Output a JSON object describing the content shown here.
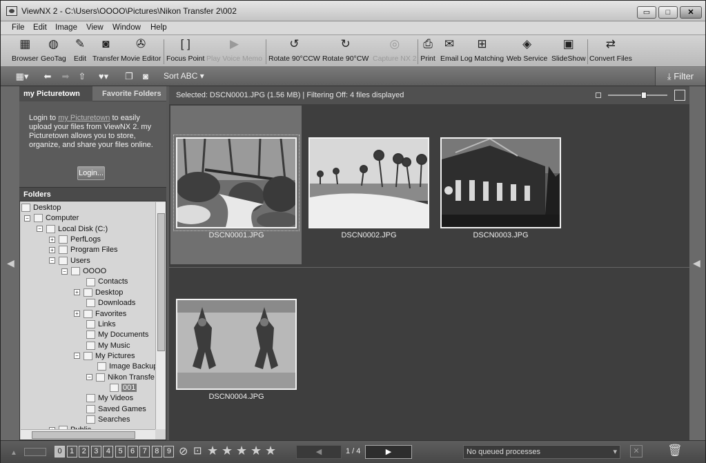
{
  "window": {
    "title": "ViewNX 2 - C:\\Users\\OOOO\\Pictures\\Nikon Transfer 2\\002",
    "min_label": "▭",
    "max_label": "□",
    "close_label": "✕"
  },
  "menu": [
    "File",
    "Edit",
    "Image",
    "View",
    "Window",
    "Help"
  ],
  "toolbar": [
    {
      "label": "Browser",
      "icon": "browser-icon",
      "glyph": "▦",
      "enabled": true
    },
    {
      "label": "GeoTag",
      "icon": "globe-icon",
      "glyph": "◍",
      "enabled": true
    },
    {
      "label": "Edit",
      "icon": "pencil-icon",
      "glyph": "✎",
      "enabled": true
    },
    {
      "label": "Transfer",
      "icon": "camera-icon",
      "glyph": "◙",
      "enabled": true
    },
    {
      "label": "Movie Editor",
      "icon": "film-reel-icon",
      "glyph": "✇",
      "enabled": true
    },
    {
      "label": "Focus Point",
      "icon": "focus-bracket-icon",
      "glyph": "[ ]",
      "enabled": true
    },
    {
      "label": "Play Voice Memo",
      "icon": "play-memo-icon",
      "glyph": "▶",
      "enabled": false
    },
    {
      "label": "Rotate 90°CCW",
      "icon": "rotate-ccw-icon",
      "glyph": "↺",
      "enabled": true
    },
    {
      "label": "Rotate 90°CW",
      "icon": "rotate-cw-icon",
      "glyph": "↻",
      "enabled": true
    },
    {
      "label": "Capture NX 2",
      "icon": "capture-nx-icon",
      "glyph": "◎",
      "enabled": false
    },
    {
      "label": "Print",
      "icon": "printer-icon",
      "glyph": "⎙",
      "enabled": true
    },
    {
      "label": "Email",
      "icon": "envelope-icon",
      "glyph": "✉",
      "enabled": true
    },
    {
      "label": "Log Matching",
      "icon": "log-matching-icon",
      "glyph": "⊞",
      "enabled": true
    },
    {
      "label": "Web Service",
      "icon": "web-service-icon",
      "glyph": "◈",
      "enabled": true
    },
    {
      "label": "SlideShow",
      "icon": "slideshow-icon",
      "glyph": "▣",
      "enabled": true
    },
    {
      "label": "Convert Files",
      "icon": "convert-files-icon",
      "glyph": "⇄",
      "enabled": true
    }
  ],
  "toolbar2": {
    "sort_label": "Sort ABC ▾",
    "filter_label": "Filter"
  },
  "left_panel": {
    "tab_active": "my Picturetown",
    "tab_inactive": "Favorite Folders",
    "text_pre": "Login to ",
    "text_link": "my Picturetown",
    "text_post": " to easily upload your files from ViewNX 2. my Picturetown allows you to store, organize, and share your files online.",
    "login_label": "Login...",
    "folders_header": "Folders"
  },
  "tree": [
    {
      "label": "Desktop",
      "indent": 0,
      "toggle": ""
    },
    {
      "label": "Computer",
      "indent": 1,
      "toggle": "−"
    },
    {
      "label": "Local Disk (C:)",
      "indent": 2,
      "toggle": "−"
    },
    {
      "label": "PerfLogs",
      "indent": 3,
      "toggle": "+"
    },
    {
      "label": "Program Files",
      "indent": 3,
      "toggle": "+"
    },
    {
      "label": "Users",
      "indent": 3,
      "toggle": "−"
    },
    {
      "label": "OOOO",
      "indent": 4,
      "toggle": "−"
    },
    {
      "label": "Contacts",
      "indent": 5,
      "toggle": ""
    },
    {
      "label": "Desktop",
      "indent": 5,
      "toggle": "+"
    },
    {
      "label": "Downloads",
      "indent": 5,
      "toggle": ""
    },
    {
      "label": "Favorites",
      "indent": 5,
      "toggle": "+"
    },
    {
      "label": "Links",
      "indent": 5,
      "toggle": ""
    },
    {
      "label": "My Documents",
      "indent": 5,
      "toggle": ""
    },
    {
      "label": "My Music",
      "indent": 5,
      "toggle": ""
    },
    {
      "label": "My Pictures",
      "indent": 5,
      "toggle": "−"
    },
    {
      "label": "Image Backup",
      "indent": 6,
      "toggle": ""
    },
    {
      "label": "Nikon Transfe",
      "indent": 6,
      "toggle": "−"
    },
    {
      "label": "001",
      "indent": 7,
      "toggle": "",
      "selected": true
    },
    {
      "label": "My Videos",
      "indent": 5,
      "toggle": ""
    },
    {
      "label": "Saved Games",
      "indent": 5,
      "toggle": ""
    },
    {
      "label": "Searches",
      "indent": 5,
      "toggle": ""
    },
    {
      "label": "Public",
      "indent": 3,
      "toggle": "+"
    }
  ],
  "main": {
    "info": "Selected: DSCN0001.JPG (1.56 MB) | Filtering Off: 4 files displayed",
    "zoom_level": 0.6,
    "thumbnails": [
      {
        "name": "DSCN0001.JPG",
        "subject": "waterfall-rocks",
        "selected": true
      },
      {
        "name": "DSCN0002.JPG",
        "subject": "beach-palms",
        "selected": false
      },
      {
        "name": "DSCN0003.JPG",
        "subject": "building-night",
        "selected": false
      },
      {
        "name": "DSCN0004.JPG",
        "subject": "temple-statues",
        "selected": false
      }
    ]
  },
  "status": {
    "labels": [
      "0",
      "1",
      "2",
      "3",
      "4",
      "5",
      "6",
      "7",
      "8",
      "9"
    ],
    "active_label": "0",
    "rating_count": 5,
    "page_text": "1 / 4",
    "prev_label": "◀",
    "next_label": "▶",
    "queue_text": "No queued processes"
  }
}
